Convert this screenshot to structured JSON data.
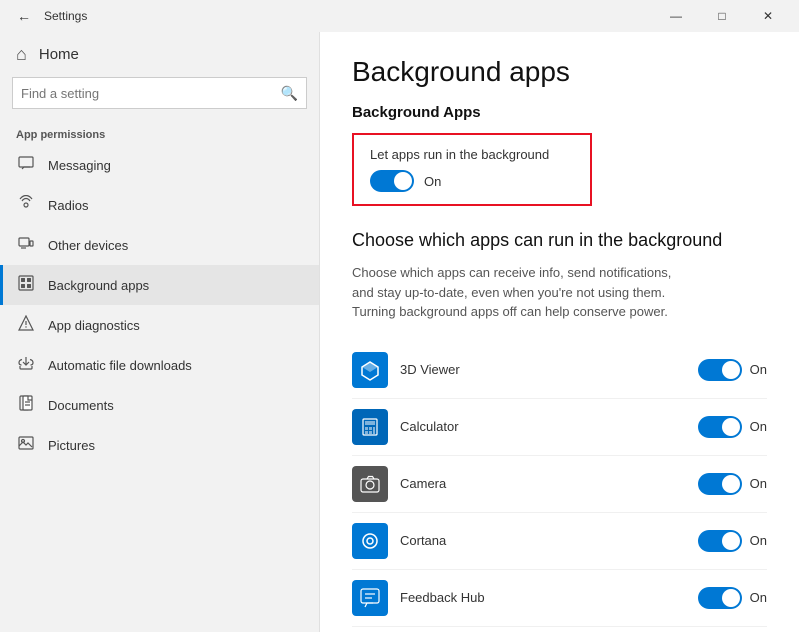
{
  "window": {
    "title": "Settings",
    "controls": {
      "minimize": "—",
      "maximize": "□",
      "close": "✕"
    }
  },
  "sidebar": {
    "home_label": "Home",
    "home_icon": "⌂",
    "search_placeholder": "Find a setting",
    "search_icon": "🔍",
    "section_title": "App permissions",
    "nav_items": [
      {
        "id": "messaging",
        "label": "Messaging",
        "icon": "💬"
      },
      {
        "id": "radios",
        "label": "Radios",
        "icon": "📡"
      },
      {
        "id": "other-devices",
        "label": "Other devices",
        "icon": "🖥"
      },
      {
        "id": "background-apps",
        "label": "Background apps",
        "icon": "📋",
        "active": true
      },
      {
        "id": "app-diagnostics",
        "label": "App diagnostics",
        "icon": "🛡"
      },
      {
        "id": "auto-downloads",
        "label": "Automatic file downloads",
        "icon": "☁"
      },
      {
        "id": "documents",
        "label": "Documents",
        "icon": "📄"
      },
      {
        "id": "pictures",
        "label": "Pictures",
        "icon": "🖼"
      }
    ]
  },
  "main": {
    "page_title": "Background apps",
    "section_title": "Background Apps",
    "toggle": {
      "label": "Let apps run in the background",
      "state": "On",
      "enabled": true
    },
    "choose_title": "Choose which apps can run in the background",
    "choose_description": "Choose which apps can receive info, send notifications, and stay up-to-date, even when you're not using them. Turning background apps off can help conserve power.",
    "apps": [
      {
        "id": "3d-viewer",
        "name": "3D Viewer",
        "state": "On",
        "enabled": true,
        "icon_char": "◈",
        "icon_class": "viewer"
      },
      {
        "id": "calculator",
        "name": "Calculator",
        "state": "On",
        "enabled": true,
        "icon_char": "⊞",
        "icon_class": "calculator"
      },
      {
        "id": "camera",
        "name": "Camera",
        "state": "On",
        "enabled": true,
        "icon_char": "⊙",
        "icon_class": "camera"
      },
      {
        "id": "cortana",
        "name": "Cortana",
        "state": "On",
        "enabled": true,
        "icon_char": "◎",
        "icon_class": "cortana"
      },
      {
        "id": "feedback-hub",
        "name": "Feedback Hub",
        "state": "On",
        "enabled": true,
        "icon_char": "✦",
        "icon_class": "feedback"
      }
    ]
  }
}
